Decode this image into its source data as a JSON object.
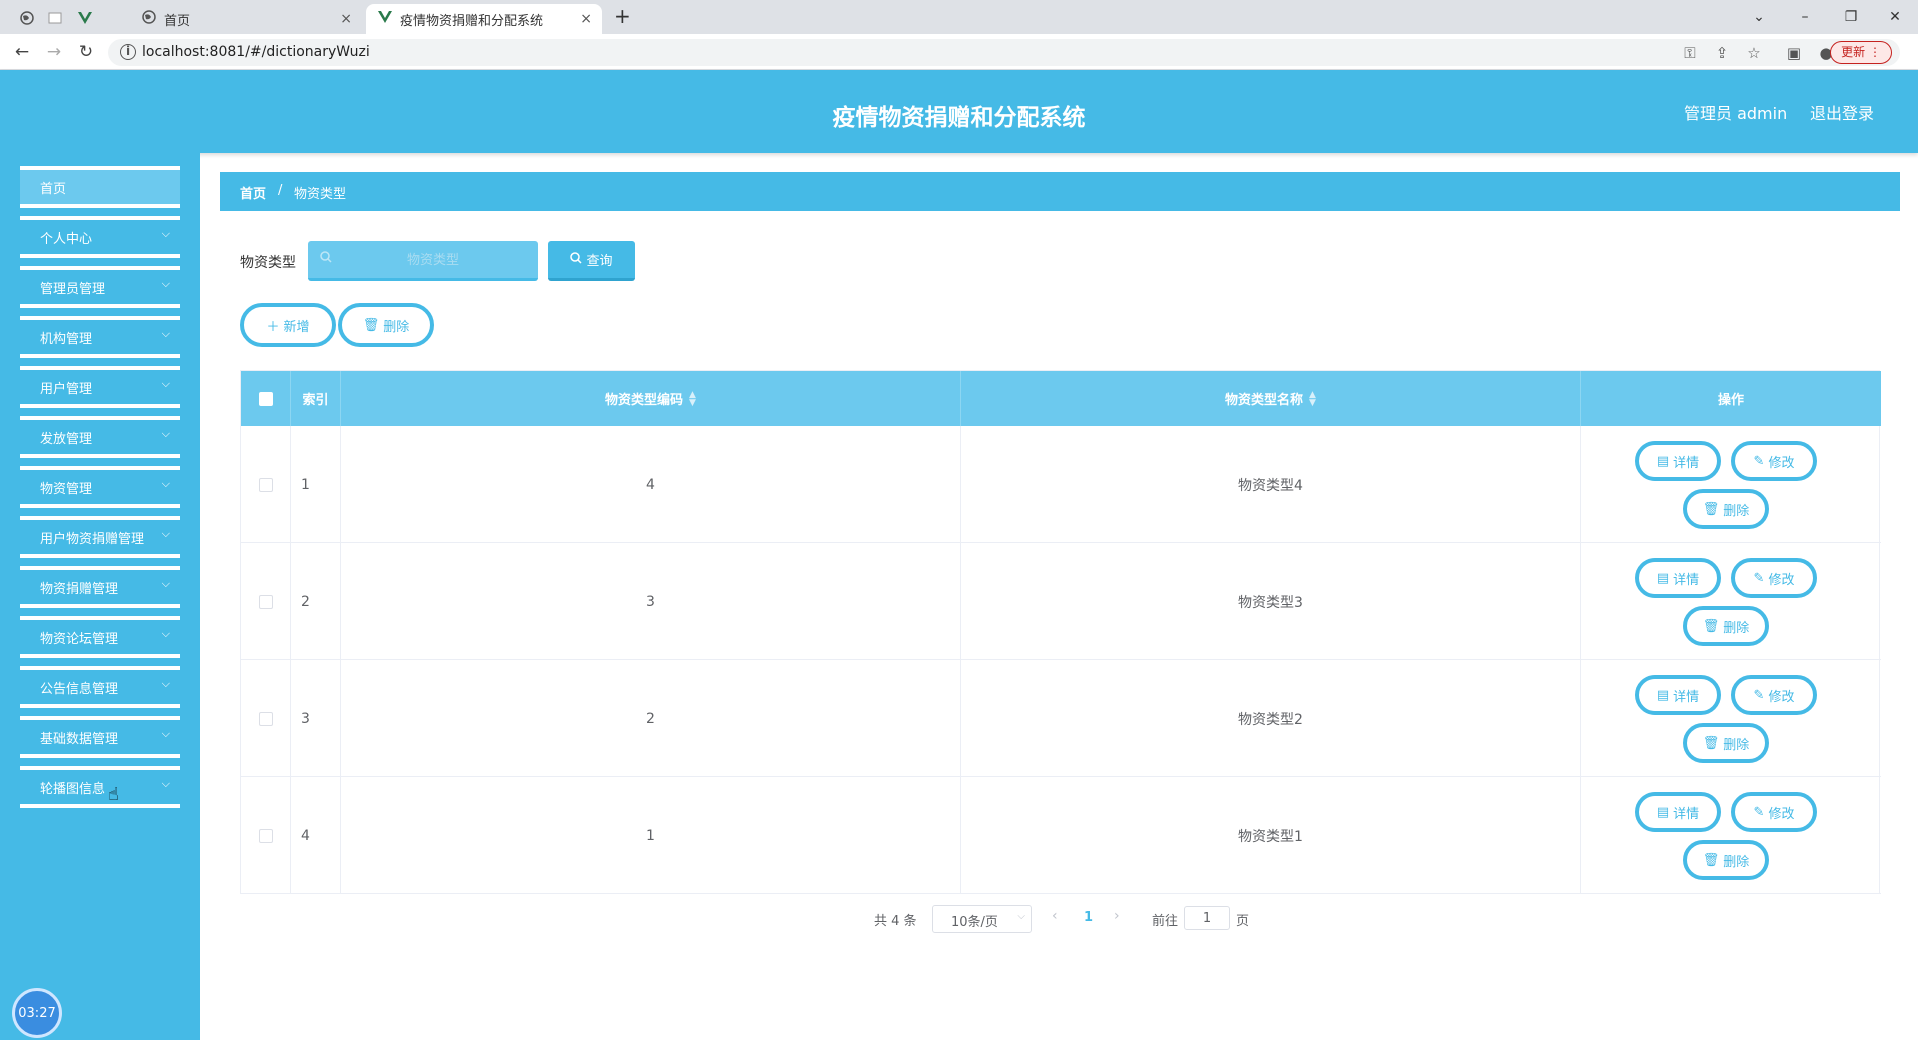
{
  "browser": {
    "tabs": [
      {
        "label": "首页"
      },
      {
        "label": "疫情物资捐赠和分配系统"
      }
    ],
    "url": "localhost:8081/#/dictionaryWuzi",
    "update_label": "更新",
    "new_tab": "+",
    "tab_close": "×"
  },
  "header": {
    "title": "疫情物资捐赠和分配系统",
    "user": "管理员 admin",
    "logout": "退出登录"
  },
  "sidebar": {
    "items": [
      {
        "label": "首页",
        "has_children": false
      },
      {
        "label": "个人中心",
        "has_children": true
      },
      {
        "label": "管理员管理",
        "has_children": true
      },
      {
        "label": "机构管理",
        "has_children": true
      },
      {
        "label": "用户管理",
        "has_children": true
      },
      {
        "label": "发放管理",
        "has_children": true
      },
      {
        "label": "物资管理",
        "has_children": true
      },
      {
        "label": "用户物资捐赠管理",
        "has_children": true
      },
      {
        "label": "物资捐赠管理",
        "has_children": true
      },
      {
        "label": "物资论坛管理",
        "has_children": true
      },
      {
        "label": "公告信息管理",
        "has_children": true
      },
      {
        "label": "基础数据管理",
        "has_children": true
      },
      {
        "label": "轮播图信息",
        "has_children": true
      }
    ],
    "clock": "03:27"
  },
  "breadcrumb": {
    "home": "首页",
    "separator": "/",
    "current": "物资类型"
  },
  "search": {
    "label": "物资类型",
    "placeholder": "物资类型",
    "value": "",
    "button": "查询"
  },
  "actions": {
    "add": "新增",
    "delete": "删除"
  },
  "table": {
    "columns": [
      "索引",
      "物资类型编码",
      "物资类型名称",
      "操作"
    ],
    "rows": [
      {
        "index": "1",
        "code": "4",
        "name": "物资类型4"
      },
      {
        "index": "2",
        "code": "3",
        "name": "物资类型3"
      },
      {
        "index": "3",
        "code": "2",
        "name": "物资类型2"
      },
      {
        "index": "4",
        "code": "1",
        "name": "物资类型1"
      }
    ],
    "row_actions": {
      "detail": "详情",
      "edit": "修改",
      "delete": "删除"
    }
  },
  "pagination": {
    "total": "共 4 条",
    "page_size": "10条/页",
    "current_page": "1",
    "goto_label": "前往",
    "goto_value": "1",
    "page_suffix": "页"
  },
  "colors": {
    "primary": "#45bae6",
    "primary_light": "#6cc9ee"
  }
}
